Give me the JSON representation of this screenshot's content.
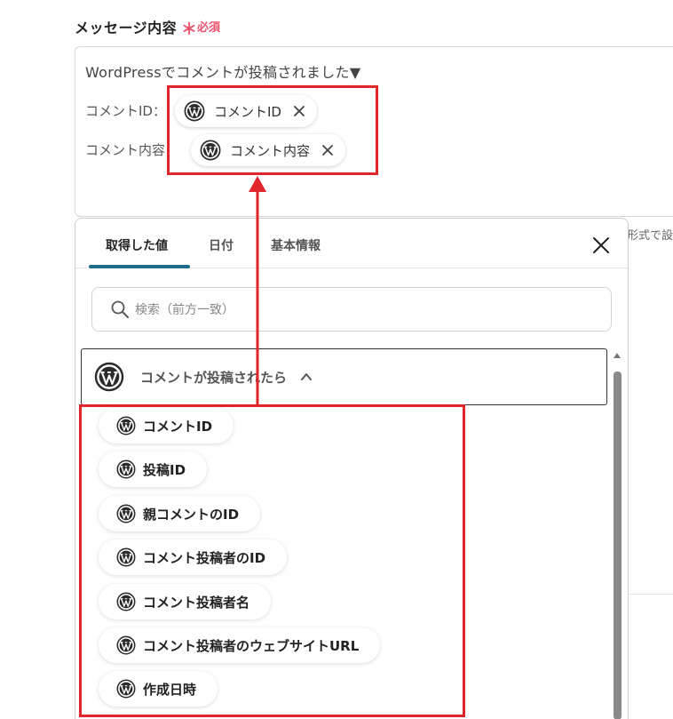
{
  "field": {
    "label": "メッセージ内容",
    "required_star": "＊",
    "required_text": "必須"
  },
  "editor": {
    "line1": "WordPressでコメントが投稿されました▼",
    "rows": [
      {
        "label": "コメントID：",
        "chip": "コメントID"
      },
      {
        "label": "コメント内容：",
        "chip": "コメント内容"
      }
    ]
  },
  "hint": "形式で設",
  "panel": {
    "tabs": [
      {
        "label": "取得した値",
        "active": true
      },
      {
        "label": "日付",
        "active": false
      },
      {
        "label": "基本情報",
        "active": false
      }
    ],
    "search_placeholder": "検索（前方一致）",
    "group_title": "コメントが投稿されたら",
    "items": [
      "コメントID",
      "投稿ID",
      "親コメントのID",
      "コメント投稿者のID",
      "コメント投稿者名",
      "コメント投稿者のウェブサイトURL",
      "作成日時"
    ]
  },
  "icons": {
    "wordpress": "wordpress-icon",
    "remove": "close-icon",
    "search": "search-icon",
    "collapse": "chevron-up-icon"
  },
  "colors": {
    "highlight": "#e0252b",
    "required": "#e8506b",
    "tab_active": "#1f6b8a"
  }
}
